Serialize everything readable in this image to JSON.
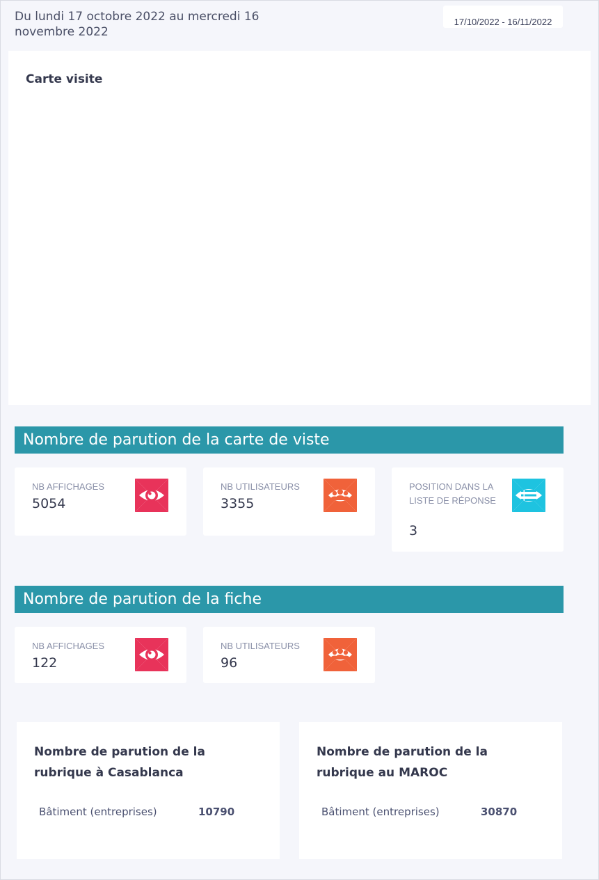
{
  "header": {
    "period_text": "Du lundi 17 octobre 2022 au mercredi 16 novembre 2022",
    "date_range": "17/10/2022 - 16/11/2022"
  },
  "map_card": {
    "title": "Carte visite"
  },
  "section_carte": {
    "title": "Nombre de parution de la carte de viste",
    "stats": [
      {
        "label": "NB AFFICHAGES",
        "value": "5054",
        "icon": "eye-icon",
        "color": "#e8335a"
      },
      {
        "label": "NB UTILISATEURS",
        "value": "3355",
        "icon": "users-icon",
        "color": "#f0623a"
      },
      {
        "label": "POSITION DANS LA LISTE DE RÉPONSE",
        "value": "3",
        "icon": "list-icon",
        "color": "#1ec3e0"
      }
    ]
  },
  "section_fiche": {
    "title": "Nombre de parution de la fiche",
    "stats": [
      {
        "label": "NB AFFICHAGES",
        "value": "122",
        "icon": "eye-icon",
        "color": "#e8335a"
      },
      {
        "label": "NB UTILISATEURS",
        "value": "96",
        "icon": "users-icon",
        "color": "#f0623a"
      }
    ]
  },
  "rubriques": [
    {
      "title": "Nombre de parution de la rubrique à Casablanca",
      "row_label": "Bâtiment (entreprises)",
      "row_value": "10790"
    },
    {
      "title": "Nombre de parution de la rubrique au MAROC",
      "row_label": "Bâtiment (entreprises)",
      "row_value": "30870"
    }
  ],
  "colors": {
    "section_header": "#2b97a9",
    "page_background": "#f5f6fb",
    "eye": "#e8335a",
    "users": "#f0623a",
    "list": "#1ec3e0"
  }
}
